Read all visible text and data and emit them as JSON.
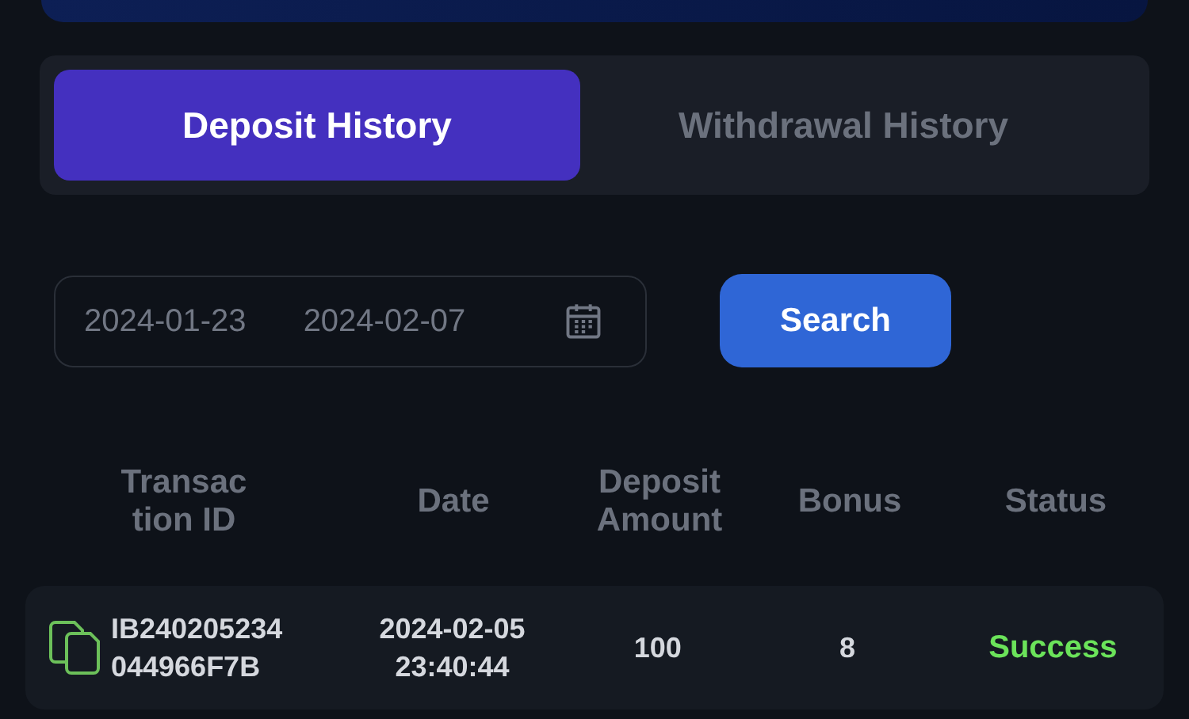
{
  "tabs": [
    {
      "label": "Deposit History",
      "selected": true
    },
    {
      "label": "Withdrawal History",
      "selected": false
    }
  ],
  "date_range": {
    "start": "2024-01-23",
    "end": "2024-02-07"
  },
  "search_button": "Search",
  "table": {
    "columns": [
      {
        "lines": [
          "Transac",
          "tion ID"
        ]
      },
      {
        "lines": [
          "Date"
        ]
      },
      {
        "lines": [
          "Deposit",
          "Amount"
        ]
      },
      {
        "lines": [
          "Bonus"
        ]
      },
      {
        "lines": [
          "Status"
        ]
      }
    ],
    "rows": [
      {
        "transaction_id": [
          "IB240205234",
          "044966F7B"
        ],
        "date": [
          "2024-02-05",
          "23:40:44"
        ],
        "amount": "100",
        "bonus": "8",
        "status": {
          "text": "Success",
          "kind": "success"
        }
      }
    ]
  }
}
